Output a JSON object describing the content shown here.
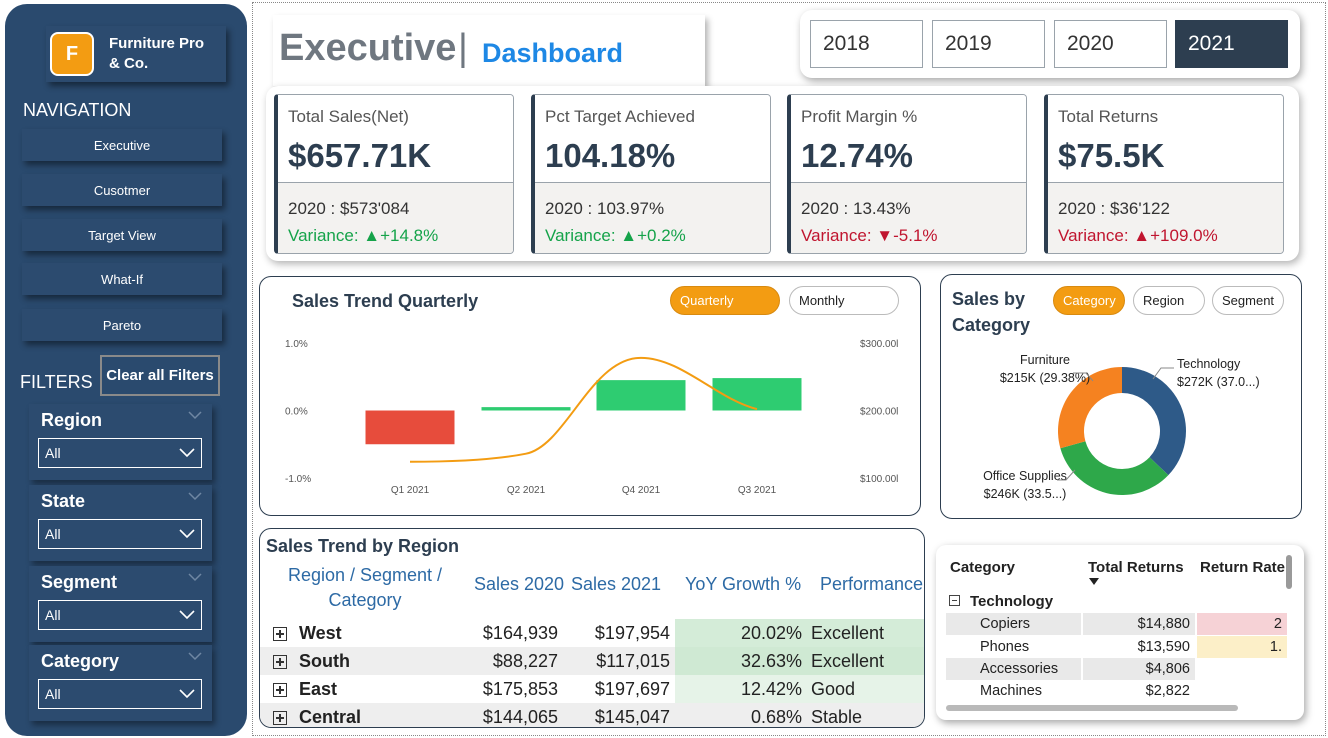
{
  "brand": {
    "initial": "F",
    "name": "Furniture Pro\n& Co.",
    "accent": "#f39c12"
  },
  "nav": {
    "heading": "NAVIGATION",
    "items": [
      "Executive",
      "Cusotmer",
      "Target View",
      "What-If",
      "Pareto"
    ]
  },
  "filters": {
    "heading": "FILTERS",
    "clear_label": "Clear all Filters",
    "items": [
      {
        "title": "Region",
        "value": "All"
      },
      {
        "title": "State",
        "value": "All"
      },
      {
        "title": "Segment",
        "value": "All"
      },
      {
        "title": "Category",
        "value": "All"
      }
    ]
  },
  "header": {
    "title": "Executive",
    "separator": "|",
    "subtitle": "Dashboard"
  },
  "years": {
    "options": [
      "2018",
      "2019",
      "2020",
      "2021"
    ],
    "selected": "2021"
  },
  "kpis": [
    {
      "label": "Total Sales(Net)",
      "value": "$657.71K",
      "prev": "2020 : $573'084",
      "variance_prefix": "Variance: ",
      "variance_arrow": "▲",
      "variance": "+14.8%",
      "status": "green"
    },
    {
      "label": "Pct Target Achieved",
      "value": "104.18%",
      "prev": "2020 : 103.97%",
      "variance_prefix": "Variance: ",
      "variance_arrow": "▲",
      "variance": "+0.2%",
      "status": "green"
    },
    {
      "label": "Profit Margin %",
      "value": "12.74%",
      "prev": "2020 : 13.43%",
      "variance_prefix": "Variance: ",
      "variance_arrow": "▼",
      "variance": "-5.1%",
      "status": "red"
    },
    {
      "label": "Total Returns",
      "value": "$75.5K",
      "prev": "2020 : $36'122",
      "variance_prefix": "Variance: ",
      "variance_arrow": "▲",
      "variance": "+109.0%",
      "status": "red"
    }
  ],
  "trend": {
    "title": "Sales Trend Quarterly",
    "toggle": {
      "options": [
        "Quarterly",
        "Monthly"
      ],
      "selected": "Quarterly"
    }
  },
  "category_panel": {
    "title": "Sales by Category",
    "toggle": {
      "options": [
        "Category",
        "Region",
        "Segment"
      ],
      "selected": "Category"
    }
  },
  "region_table": {
    "title": "Sales Trend by Region",
    "headers": [
      "Region / Segment / Category",
      "Sales 2020",
      "Sales 2021",
      "YoY Growth %",
      "Performance"
    ],
    "rows": [
      {
        "name": "West",
        "s2020": "$164,939",
        "s2021": "$197,954",
        "yoy": "20.02%",
        "perf": "Excellent"
      },
      {
        "name": "South",
        "s2020": "$88,227",
        "s2021": "$117,015",
        "yoy": "32.63%",
        "perf": "Excellent"
      },
      {
        "name": "East",
        "s2020": "$175,853",
        "s2021": "$197,697",
        "yoy": "12.42%",
        "perf": "Good"
      },
      {
        "name": "Central",
        "s2020": "$144,065",
        "s2021": "$145,047",
        "yoy": "0.68%",
        "perf": "Stable"
      }
    ]
  },
  "returns_table": {
    "headers": [
      "Category",
      "Total Returns",
      "Return Rate"
    ],
    "group": "Technology",
    "rows": [
      {
        "name": "Copiers",
        "returns": "$14,880",
        "rate": "2"
      },
      {
        "name": "Phones",
        "returns": "$13,590",
        "rate": "1."
      },
      {
        "name": "Accessories",
        "returns": "$4,806",
        "rate": ""
      },
      {
        "name": "Machines",
        "returns": "$2,822",
        "rate": ""
      }
    ]
  },
  "chart_data": [
    {
      "type": "bar",
      "subtype": "waterfall-with-line",
      "title": "Sales Trend Quarterly",
      "categories": [
        "Q1 2021",
        "Q2 2021",
        "Q4 2021",
        "Q3 2021"
      ],
      "waterfall": [
        {
          "start": 0.0,
          "end": -0.5,
          "color": "#e74c3c"
        },
        {
          "start": 0.0,
          "end": 0.05,
          "color": "#2ecc71"
        },
        {
          "start": 0.0,
          "end": 0.45,
          "color": "#2ecc71"
        },
        {
          "start": 0.0,
          "end": 0.48,
          "color": "#2ecc71"
        }
      ],
      "line": {
        "name": "",
        "values": [
          124,
          136,
          278,
          202
        ],
        "color": "#f39c12"
      },
      "y_left": {
        "ticks": [
          "1.0%",
          "0.0%",
          "-1.0%"
        ],
        "range": [
          -1.0,
          1.0
        ]
      },
      "y_right": {
        "ticks": [
          "$300.00l",
          "$200.00l",
          "$100.00l"
        ],
        "range": [
          100,
          300
        ]
      }
    },
    {
      "type": "pie",
      "subtype": "donut",
      "title": "Sales by Category",
      "slices": [
        {
          "name": "Technology",
          "label": "$272K (37.0...)",
          "value": 272,
          "color": "#2e5a88"
        },
        {
          "name": "Office Supplies",
          "label": "$246K (33.5...)",
          "value": 246,
          "color": "#2ea84a"
        },
        {
          "name": "Furniture",
          "label": "$215K (29.38%)",
          "value": 215,
          "color": "#f58220"
        }
      ]
    }
  ]
}
